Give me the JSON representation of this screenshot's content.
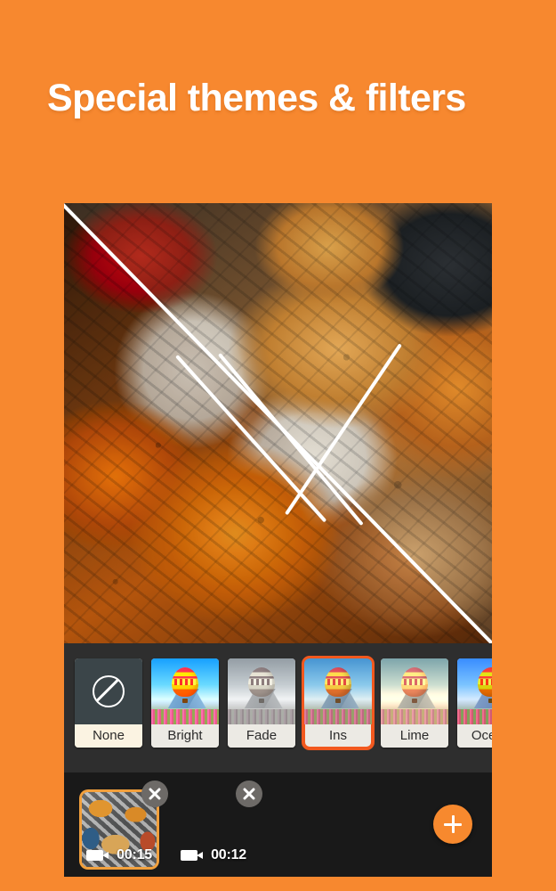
{
  "promo": {
    "title": "Special themes & filters",
    "background_color": "#F7882F"
  },
  "app": {
    "accent_color": "#F2581E",
    "panel_color": "#2E2E2E",
    "timeline_color": "#191919"
  },
  "preview": {
    "name": "video-preview",
    "description": "Food photo with diagonal split filter comparison overlay"
  },
  "filters": {
    "selected": "Ins",
    "items": [
      {
        "label": "None",
        "icon": "no-filter-icon",
        "selected": false
      },
      {
        "label": "Bright",
        "icon": "balloon-thumb",
        "selected": false
      },
      {
        "label": "Fade",
        "icon": "balloon-thumb",
        "selected": false
      },
      {
        "label": "Ins",
        "icon": "balloon-thumb",
        "selected": true
      },
      {
        "label": "Lime",
        "icon": "balloon-thumb",
        "selected": false
      },
      {
        "label": "Ocean",
        "icon": "balloon-thumb",
        "selected": false
      }
    ]
  },
  "timeline": {
    "clips": [
      {
        "duration": "00:15",
        "selected": true,
        "close_label": "×",
        "media_icon": "video-camera-icon"
      },
      {
        "duration": "00:12",
        "selected": false,
        "close_label": "×",
        "media_icon": "video-camera-icon"
      }
    ],
    "add_button": {
      "label": "+",
      "icon": "plus-icon"
    }
  }
}
